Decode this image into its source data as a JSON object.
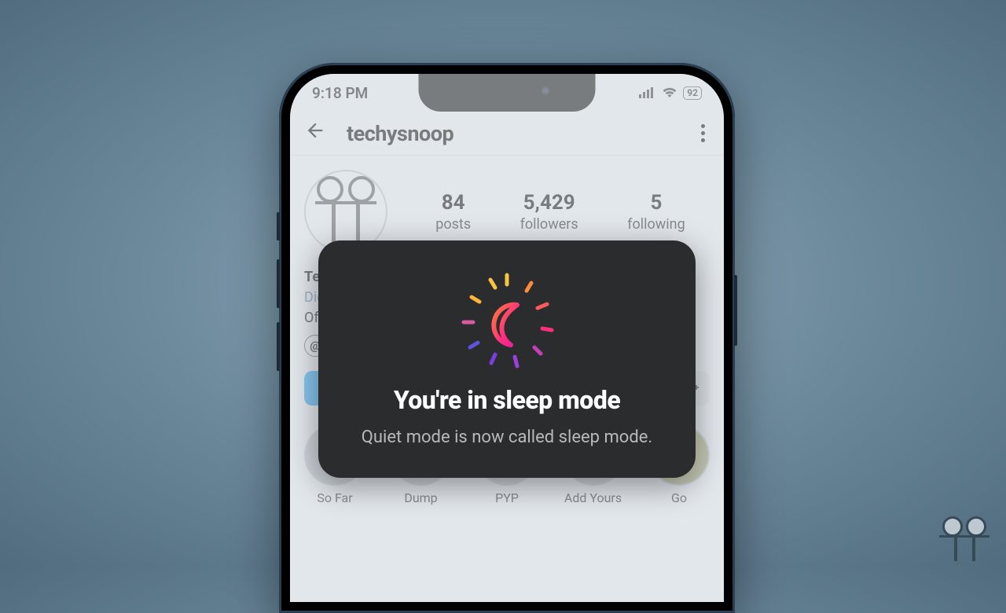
{
  "status": {
    "time": "9:18 PM",
    "battery": "92"
  },
  "header": {
    "username": "techysnoop"
  },
  "profile": {
    "stats": {
      "posts_count": "84",
      "posts_label": "posts",
      "followers_count": "5,429",
      "followers_label": "followers",
      "following_count": "5",
      "following_label": "following"
    },
    "bio_name": "Te",
    "bio_category": "Dig",
    "bio_line": "Of",
    "threads_badge": "@"
  },
  "buttons": {
    "follow": " "
  },
  "highlights": [
    {
      "label": "So Far"
    },
    {
      "label": "Dump"
    },
    {
      "label": "PYP"
    },
    {
      "label": "Add Yours"
    },
    {
      "label": "Go"
    }
  ],
  "modal": {
    "title": "You're in sleep mode",
    "subtitle": "Quiet mode is now called sleep mode."
  }
}
